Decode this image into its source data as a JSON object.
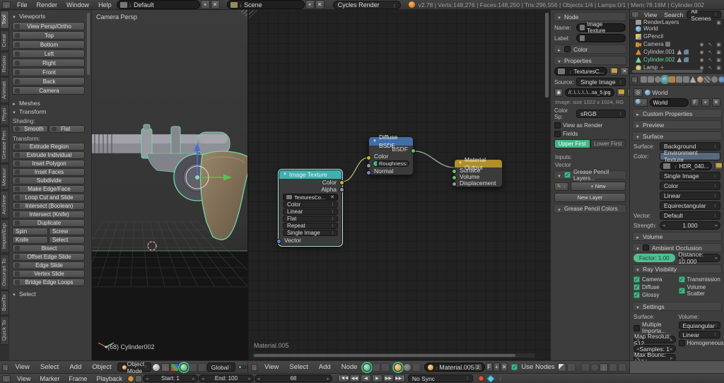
{
  "topbar": {
    "menus": [
      "File",
      "Render",
      "Window",
      "Help"
    ],
    "layout": "Default",
    "scene": "Scene",
    "engine": "Cycles Render",
    "stats": "v2.78 | Verts:148,276 | Faces:148,250 | Tris:296,556 | Objects:1/4 | Lamps:0/1 | Mem:78.16M | Cylinder.002"
  },
  "toolshelf": {
    "tabs": [
      "Tool",
      "Creat",
      "Relatio",
      "Animati",
      "Physi",
      "Grease Pen",
      "Measur",
      "Archime",
      "Import/Exp",
      "Oscurart To",
      "BoolTo",
      "Quick To"
    ],
    "viewports_title": "Viewports",
    "view_buttons": [
      "View Persp/Ortho",
      "Top",
      "Bottom",
      "Left",
      "Right",
      "Front",
      "Back",
      "Camera"
    ],
    "meshes_title": "Meshes",
    "transform_title": "Transform",
    "shading_label": "Shading:",
    "smooth": "Smooth",
    "flat": "Flat",
    "transform_label": "Transform:",
    "edit_buttons": [
      "Extrude Region",
      "Extrude Individual",
      "Inset Polygon",
      "Inset Faces",
      "Subdivide",
      "Make Edge/Face",
      "Loop Cut and Slide",
      "Intersect (Boolean)",
      "Intersect (Knife)",
      "Duplicate"
    ],
    "pair_buttons": [
      "Spin",
      "Screw",
      "Knife",
      "Select"
    ],
    "edit_buttons2": [
      "Bisect",
      "Offset Edge Slide",
      "Edge Slide",
      "Vertex Slide",
      "Bridge Edge Loops"
    ],
    "select_title": "Select"
  },
  "viewport": {
    "view_label": "Camera Persp",
    "object_label": "(68) Cylinder002"
  },
  "nodes": {
    "image_texture": {
      "title": "Image Texture",
      "out_color": "Color",
      "out_alpha": "Alpha",
      "datablock": "TexturesCo...",
      "dd": [
        "Color",
        "Linear",
        "Flat",
        "Repeat",
        "Single Image"
      ],
      "in_vector": "Vector"
    },
    "diffuse": {
      "title": "Diffuse BSDF",
      "out": "BSDF",
      "in_color": "Color",
      "roughness": "Roughness: 0.000",
      "in_normal": "Normal"
    },
    "output": {
      "title": "Material Output",
      "in_surface": "Surface",
      "in_volume": "Volume",
      "in_displacement": "Displacement"
    },
    "backdrop_label": "Material.005"
  },
  "npanel": {
    "node_title": "Node",
    "name_label": "Name:",
    "name_value": "Image Texture",
    "label_label": "Label:",
    "color_title": "Color",
    "props_title": "Properties",
    "datablock": "TexturesC...",
    "source_label": "Source:",
    "source": "Single Image",
    "filepath": "//..\\..\\..\\..\\...sa_5.jpg",
    "image_info": "Image: size 1022 x 1024, RG",
    "colorspace_label": "Color Sp:",
    "colorspace": "sRGB",
    "view_as_render": "View as Render",
    "fields": "Fields",
    "upper_first": "Upper First",
    "lower_first": "Lower First",
    "inputs_label": "Inputs:",
    "vector_label": "Vector",
    "gp_layers_title": "Grease Pencil Layers...",
    "new_btn": "New",
    "new_layer_btn": "New Layer",
    "gp_colors_title": "Grease Pencil Colors"
  },
  "outliner": {
    "menus": [
      "View",
      "Search"
    ],
    "scenes": "All Scenes",
    "items": [
      {
        "label": "RenderLayers"
      },
      {
        "label": "World"
      },
      {
        "label": "GPencil"
      },
      {
        "label": "Camera"
      },
      {
        "label": "Cylinder.001"
      },
      {
        "label": "Cylinder.002"
      },
      {
        "label": "Lamp"
      }
    ]
  },
  "properties": {
    "breadcrumb": "World",
    "datablock": "World",
    "fake_user": "F",
    "custom_props_title": "Custom Properties",
    "preview_title": "Preview",
    "surface_title": "Surface",
    "surface_label": "Surface:",
    "surface_value": "Background",
    "color_label": "Color:",
    "color_value": "Environment Texture",
    "image_name": "HDR_040...",
    "image_dd": [
      "Single Image",
      "Color",
      "Linear",
      "Equirectangular"
    ],
    "vector_label": "Vector:",
    "vector_value": "Default",
    "strength_label": "Strength:",
    "strength_value": "1.000",
    "volume_title": "Volume",
    "ao_title": "Ambient Occlusion",
    "factor": "Factor: 1.00",
    "distance": "Distance: 10.000",
    "ray_title": "Ray Visibility",
    "ray_left": [
      "Camera",
      "Diffuse",
      "Glossy"
    ],
    "ray_right": [
      "Transmission",
      "Volume Scatter"
    ],
    "settings_title": "Settings",
    "surface_col": "Surface:",
    "volume_col": "Volume:",
    "multiple_importance": "Multiple Importa...",
    "map_res": "Map Resoluti: 512",
    "samples": "Samples: 1",
    "max_bounces": "Max Bounc: 1024",
    "vol_sampling": "Equiangular",
    "vol_interp": "Linear",
    "homogeneous": "Homogeneous"
  },
  "headers": {
    "view3d": {
      "menus": [
        "View",
        "Select",
        "Add",
        "Object"
      ],
      "mode": "Object Mode",
      "orientation": "Global"
    },
    "node": {
      "menus": [
        "View",
        "Select",
        "Add",
        "Node"
      ],
      "material": "Material.005",
      "users": "2",
      "fake": "F",
      "use_nodes": "Use Nodes"
    }
  },
  "timeline": {
    "menus": [
      "View",
      "Marker",
      "Frame",
      "Playback"
    ],
    "start_label": "Start:",
    "start": "1",
    "end_label": "End:",
    "end": "100",
    "frame": "68",
    "sync": "No Sync"
  }
}
